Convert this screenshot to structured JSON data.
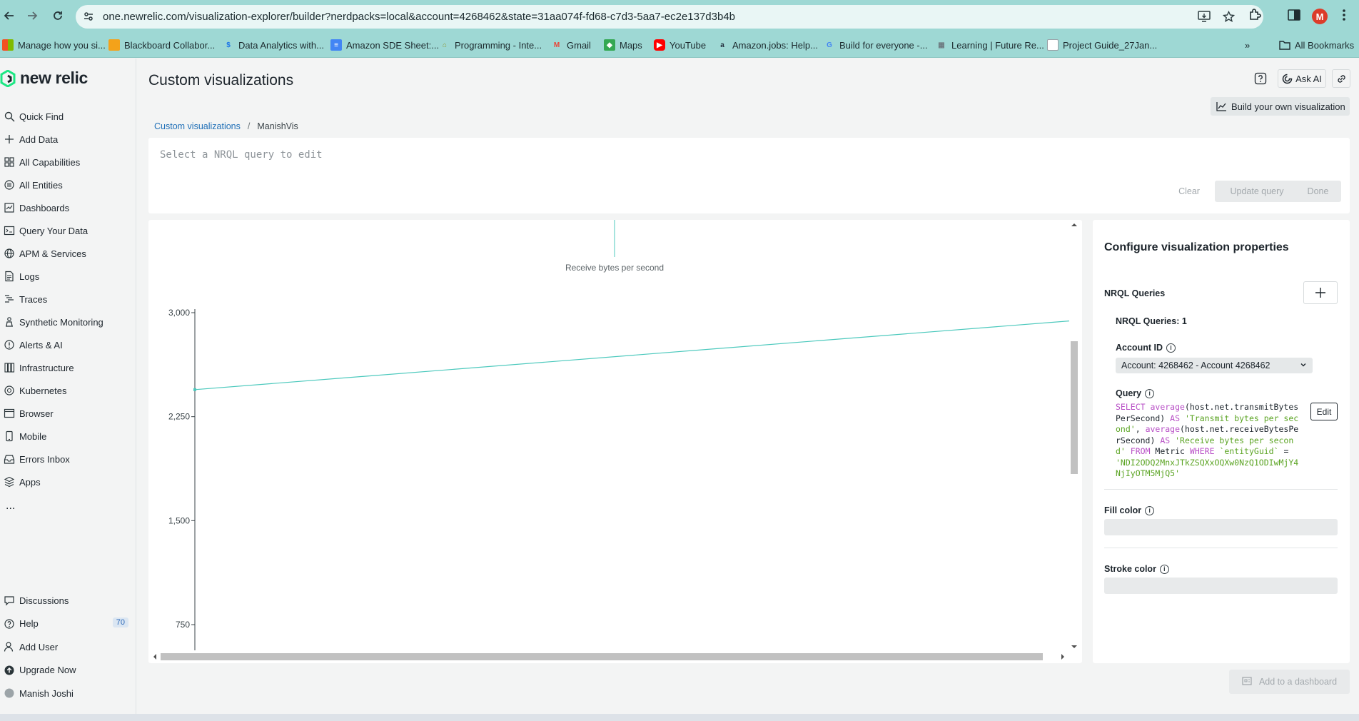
{
  "browser": {
    "url": "one.newrelic.com/visualization-explorer/builder?nerdpacks=local&account=4268462&state=31aa074f-fd68-c7d3-5aa7-ec2e137d3b4b",
    "profile_initial": "M",
    "bookmarks": [
      {
        "label": "Manage how you si...",
        "color": "#f25022"
      },
      {
        "label": "Blackboard Collabor...",
        "color": "#f4a21a"
      },
      {
        "label": "Data Analytics with...",
        "color": "#1a73e8"
      },
      {
        "label": "Amazon SDE Sheet:...",
        "color": "#4285f4"
      },
      {
        "label": "Programming - Inte...",
        "color": "#8f9a3b"
      },
      {
        "label": "Gmail",
        "color": "#ea4335"
      },
      {
        "label": "Maps",
        "color": "#34a853"
      },
      {
        "label": "YouTube",
        "color": "#ff0000"
      },
      {
        "label": "Amazon.jobs: Help...",
        "color": "#232f3e"
      },
      {
        "label": "Build for everyone -...",
        "color": "#4285f4"
      },
      {
        "label": "Learning | Future Re...",
        "color": "#6d7a80"
      },
      {
        "label": "Project Guide_27Jan...",
        "color": "#9aa0a6"
      }
    ],
    "all_bookmarks": "All Bookmarks"
  },
  "sidebar": {
    "logo": "new relic",
    "items": [
      {
        "label": "Quick Find",
        "icon": "search-icon"
      },
      {
        "label": "Add Data",
        "icon": "plus-icon"
      },
      {
        "label": "All Capabilities",
        "icon": "grid-icon"
      },
      {
        "label": "All Entities",
        "icon": "entities-icon"
      },
      {
        "label": "Dashboards",
        "icon": "dashboard-icon"
      },
      {
        "label": "Query Your Data",
        "icon": "terminal-icon"
      },
      {
        "label": "APM & Services",
        "icon": "globe-icon"
      },
      {
        "label": "Logs",
        "icon": "document-icon"
      },
      {
        "label": "Traces",
        "icon": "traces-icon"
      },
      {
        "label": "Synthetic Monitoring",
        "icon": "monitor-person-icon"
      },
      {
        "label": "Alerts & AI",
        "icon": "alert-icon"
      },
      {
        "label": "Infrastructure",
        "icon": "infrastructure-icon"
      },
      {
        "label": "Kubernetes",
        "icon": "kubernetes-icon"
      },
      {
        "label": "Browser",
        "icon": "browser-icon"
      },
      {
        "label": "Mobile",
        "icon": "mobile-icon"
      },
      {
        "label": "Errors Inbox",
        "icon": "inbox-icon"
      },
      {
        "label": "Apps",
        "icon": "apps-icon"
      }
    ],
    "more": "...",
    "bottom_items": [
      {
        "label": "Discussions",
        "icon": "discussions-icon"
      },
      {
        "label": "Help",
        "icon": "help-icon",
        "badge": "70"
      },
      {
        "label": "Add User",
        "icon": "add-user-icon"
      },
      {
        "label": "Upgrade Now",
        "icon": "upgrade-icon"
      },
      {
        "label": "Manish Joshi",
        "icon": "user-icon"
      }
    ]
  },
  "header": {
    "title": "Custom visualizations",
    "ask_ai": "Ask AI",
    "build_button": "Build your own visualization"
  },
  "breadcrumb": {
    "parent": "Custom visualizations",
    "current": "ManishVis"
  },
  "query_editor": {
    "placeholder": "Select a NRQL query to edit",
    "clear": "Clear",
    "update": "Update query",
    "done": "Done"
  },
  "chart_data": {
    "type": "line",
    "title": "Receive bytes per second",
    "y_ticks": [
      "3,000",
      "2,250",
      "1,500",
      "750"
    ],
    "y_tick_values": [
      3000,
      2250,
      1500,
      750
    ],
    "series": [
      {
        "name": "Receive bytes per second",
        "values": [
          2445,
          2940
        ]
      }
    ],
    "color": "#4cc9bd"
  },
  "config": {
    "title": "Configure visualization properties",
    "nrql_queries_label": "NRQL Queries",
    "nrql_queries_count": "NRQL Queries: 1",
    "account_id_label": "Account ID",
    "account_value": "Account: 4268462 - Account 4268462",
    "query_label": "Query",
    "query_parts": [
      {
        "t": "SELECT ",
        "c": "kw"
      },
      {
        "t": "average",
        "c": "kw"
      },
      {
        "t": "(host.net.transmitBytesPerSecond) ",
        "c": ""
      },
      {
        "t": "AS ",
        "c": "kw"
      },
      {
        "t": "'Transmit bytes per second'",
        "c": "str"
      },
      {
        "t": ", ",
        "c": ""
      },
      {
        "t": "average",
        "c": "kw"
      },
      {
        "t": "(host.net.receiveBytesPerSecond) ",
        "c": ""
      },
      {
        "t": "AS ",
        "c": "kw"
      },
      {
        "t": "'Receive bytes per second'",
        "c": "str"
      },
      {
        "t": " ",
        "c": ""
      },
      {
        "t": "FROM ",
        "c": "kw"
      },
      {
        "t": "Metric ",
        "c": ""
      },
      {
        "t": "WHERE ",
        "c": "kw"
      },
      {
        "t": "`entityGuid`",
        "c": "str"
      },
      {
        "t": " = ",
        "c": ""
      },
      {
        "t": "'NDI2ODQ2MnxJTkZSQXxOQXw0NzQ1ODIwMjY4NjIyOTM5MjQ5'",
        "c": "str"
      }
    ],
    "edit": "Edit",
    "fill_color_label": "Fill color",
    "stroke_color_label": "Stroke color"
  },
  "footer": {
    "add_dashboard": "Add to a dashboard"
  }
}
